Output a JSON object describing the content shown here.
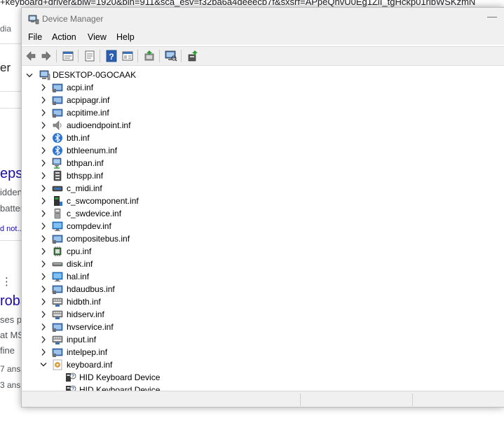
{
  "background_page": {
    "url_text": "+keyboard+driver&biw=1920&bih=911&sca_esv=f32ba6a4deeecb7f&sxsrf=APpeQnvU0Eg1ZlI_tgHckp01rlbWSKzmN",
    "fragments": [
      "dia",
      "er",
      "eps",
      "idden",
      "batter",
      "d not...",
      "⋮",
      "roba",
      "ses p",
      "at MS",
      "fine",
      "7 ans",
      "3 ans"
    ]
  },
  "window": {
    "title": "Device Manager",
    "minimize_glyph": "—"
  },
  "menu": [
    "File",
    "Action",
    "View",
    "Help"
  ],
  "toolbar": [
    "back-icon",
    "forward-icon",
    "properties-icon",
    "driver-details-icon",
    "help-icon",
    "view-icon",
    "update-driver-icon",
    "scan-hardware-icon",
    "add-driver-icon"
  ],
  "tree": {
    "root": "DESKTOP-0GOCAAK",
    "items": [
      {
        "label": "acpi.inf",
        "icon": "system-device-icon",
        "expanded": false
      },
      {
        "label": "acpipagr.inf",
        "icon": "system-device-icon",
        "expanded": false
      },
      {
        "label": "acpitime.inf",
        "icon": "system-device-icon",
        "expanded": false
      },
      {
        "label": "audioendpoint.inf",
        "icon": "speaker-icon",
        "expanded": false
      },
      {
        "label": "bth.inf",
        "icon": "bluetooth-icon",
        "expanded": false
      },
      {
        "label": "bthleenum.inf",
        "icon": "bluetooth-icon",
        "expanded": false
      },
      {
        "label": "bthpan.inf",
        "icon": "network-icon",
        "expanded": false
      },
      {
        "label": "bthspp.inf",
        "icon": "port-icon",
        "expanded": false
      },
      {
        "label": "c_midi.inf",
        "icon": "midi-icon",
        "expanded": false
      },
      {
        "label": "c_swcomponent.inf",
        "icon": "software-component-icon",
        "expanded": false
      },
      {
        "label": "c_swdevice.inf",
        "icon": "software-device-icon",
        "expanded": false
      },
      {
        "label": "compdev.inf",
        "icon": "monitor-icon",
        "expanded": false
      },
      {
        "label": "compositebus.inf",
        "icon": "system-device-icon",
        "expanded": false
      },
      {
        "label": "cpu.inf",
        "icon": "processor-icon",
        "expanded": false
      },
      {
        "label": "disk.inf",
        "icon": "disk-drive-icon",
        "expanded": false
      },
      {
        "label": "hal.inf",
        "icon": "monitor-icon",
        "expanded": false
      },
      {
        "label": "hdaudbus.inf",
        "icon": "system-device-icon",
        "expanded": false
      },
      {
        "label": "hidbth.inf",
        "icon": "hid-icon",
        "expanded": false
      },
      {
        "label": "hidserv.inf",
        "icon": "hid-icon",
        "expanded": false
      },
      {
        "label": "hvservice.inf",
        "icon": "system-device-icon",
        "expanded": false
      },
      {
        "label": "input.inf",
        "icon": "hid-icon",
        "expanded": false
      },
      {
        "label": "intelpep.inf",
        "icon": "system-device-icon",
        "expanded": false
      },
      {
        "label": "keyboard.inf",
        "icon": "inf-file-icon",
        "expanded": true
      }
    ],
    "children": [
      {
        "label": "HID Keyboard Device",
        "icon": "keyboard-device-icon"
      },
      {
        "label": "HID Keyboard Device",
        "icon": "keyboard-device-icon"
      }
    ]
  },
  "colors": {
    "accent_blue": "#1a73b8",
    "chrome": "#f0f0f0",
    "link_blue": "#1a0dab"
  }
}
